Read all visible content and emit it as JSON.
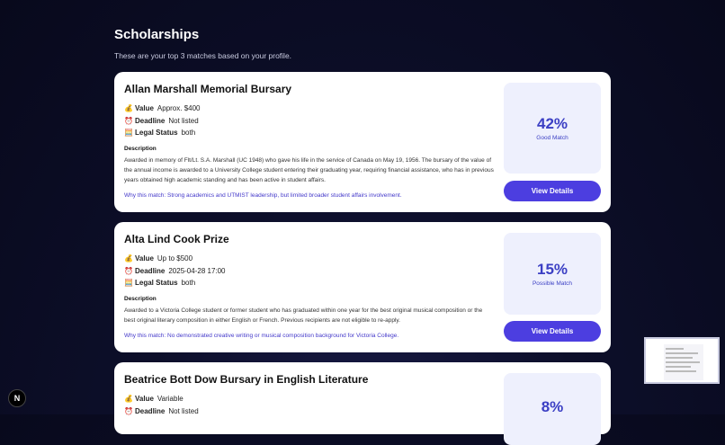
{
  "page": {
    "title": "Scholarships",
    "subtitle": "These are your top 3 matches based on your profile."
  },
  "labels": {
    "value": "Value",
    "deadline": "Deadline",
    "legal_status": "Legal Status",
    "description": "Description",
    "view_details": "View Details"
  },
  "icons": {
    "value": "money-bag-icon",
    "deadline": "alarm-clock-icon",
    "legal_status": "abacus-icon"
  },
  "cards": [
    {
      "title": "Allan Marshall Memorial Bursary",
      "value": "Approx. $400",
      "deadline": "Not listed",
      "legal_status": "both",
      "description": "Awarded in memory of Flt/Lt. S.A. Marshall (UC 1948) who gave his life in the service of Canada on May 19, 1956. The bursary of the value of the annual income is awarded to a University College student entering their graduating year, requiring financial assistance, who has in previous years obtained high academic standing and has been active in student affairs.",
      "why": "Why this match: Strong academics and UTMIST leadership, but limited broader student affairs involvement.",
      "score": "42%",
      "score_label": "Good Match"
    },
    {
      "title": "Alta Lind Cook Prize",
      "value": "Up to $500",
      "deadline": "2025-04-28 17:00",
      "legal_status": "both",
      "description": "Awarded to a Victoria College student or former student who has graduated within one year for the best original musical composition or the best original literary composition in either English or French. Previous recipients are not eligible to re-apply.",
      "why": "Why this match: No demonstrated creative writing or musical composition background for Victoria College.",
      "score": "15%",
      "score_label": "Possible Match"
    },
    {
      "title": "Beatrice Bott Dow Bursary in English Literature",
      "value": "Variable",
      "deadline": "Not listed",
      "score": "8%"
    }
  ],
  "overlay": {
    "badge": "N"
  },
  "colors": {
    "accent": "#4c3ee0",
    "score_text": "#3b3fc4",
    "score_bg": "#eef0fd",
    "why_text": "#4338ca"
  }
}
